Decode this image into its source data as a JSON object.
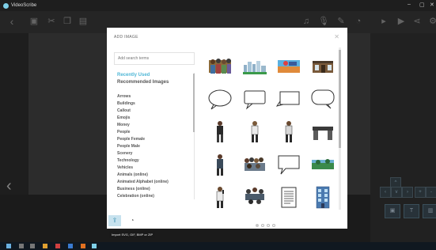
{
  "window": {
    "app_title": "VideoScribe"
  },
  "dialog": {
    "title": "ADD IMAGE",
    "search_placeholder": "Add search terms",
    "categories": [
      "Recently Used",
      "Recommended Images",
      "Arrows",
      "Buildings",
      "Callout",
      "Emojis",
      "Money",
      "People",
      "People Female",
      "People Male",
      "Scenery",
      "Technology",
      "Vehicles",
      "Animals (online)",
      "Animated Alphabet (online)",
      "Business (online)",
      "Celebration (online)"
    ],
    "active_category": "Recently Used",
    "tooltip": "Import SVG, GIF, BMP or ZIP",
    "thumbnails": [
      "group-of-people",
      "city-skyline",
      "sports-scene",
      "storefront",
      "oval-callout",
      "speech-callout",
      "square-callout",
      "round-callout",
      "man-standing",
      "man-standing",
      "man-standing",
      "desk",
      "businessman",
      "crowd",
      "speech-bubble",
      "landscape",
      "man-phone",
      "people-group",
      "document",
      "office-building"
    ],
    "pagination": {
      "pages": 4,
      "current": 1
    }
  },
  "colors": {
    "accent": "#4fb7d6",
    "dialog_bg": "#ffffff",
    "toolbar_bg": "#3a3a3a"
  }
}
